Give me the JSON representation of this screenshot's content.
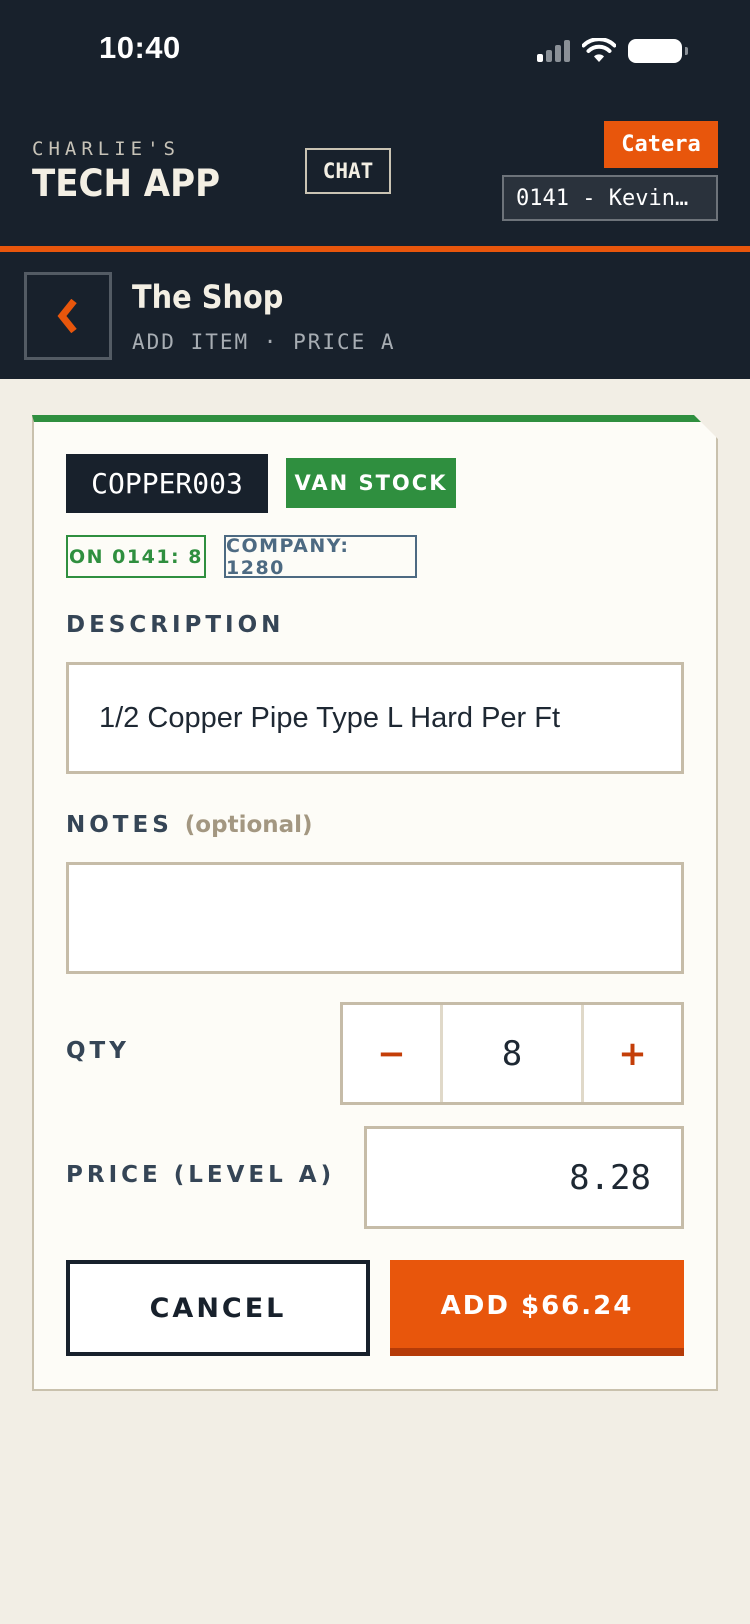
{
  "status": {
    "time": "10:40"
  },
  "header": {
    "brand_small": "CHARLIE'S",
    "brand_big": "TECH APP",
    "chat_label": "CHAT",
    "badge": "Catera",
    "tech_selector": "0141 - Kevin…"
  },
  "subheader": {
    "title": "The Shop",
    "subtitle": "ADD ITEM · PRICE A"
  },
  "item": {
    "sku": "COPPER003",
    "stock_type": "VAN STOCK",
    "van_qty_chip": "ON 0141: 8",
    "company_qty_chip": "COMPANY: 1280"
  },
  "form": {
    "description_label": "DESCRIPTION",
    "description_value": "1/2 Copper Pipe Type L Hard Per Ft",
    "notes_label": "NOTES",
    "notes_optional": "(optional)",
    "notes_value": "",
    "qty_label": "QTY",
    "qty_minus": "−",
    "qty_value": "8",
    "qty_plus": "+",
    "price_label": "PRICE (LEVEL A)",
    "price_value": "8.28"
  },
  "actions": {
    "cancel_label": "CANCEL",
    "add_label": "ADD $66.24"
  },
  "colors": {
    "header_bg": "#18212c",
    "accent_orange": "#e8560c",
    "accent_green": "#2f8f3f",
    "page_bg": "#f2eee5"
  }
}
